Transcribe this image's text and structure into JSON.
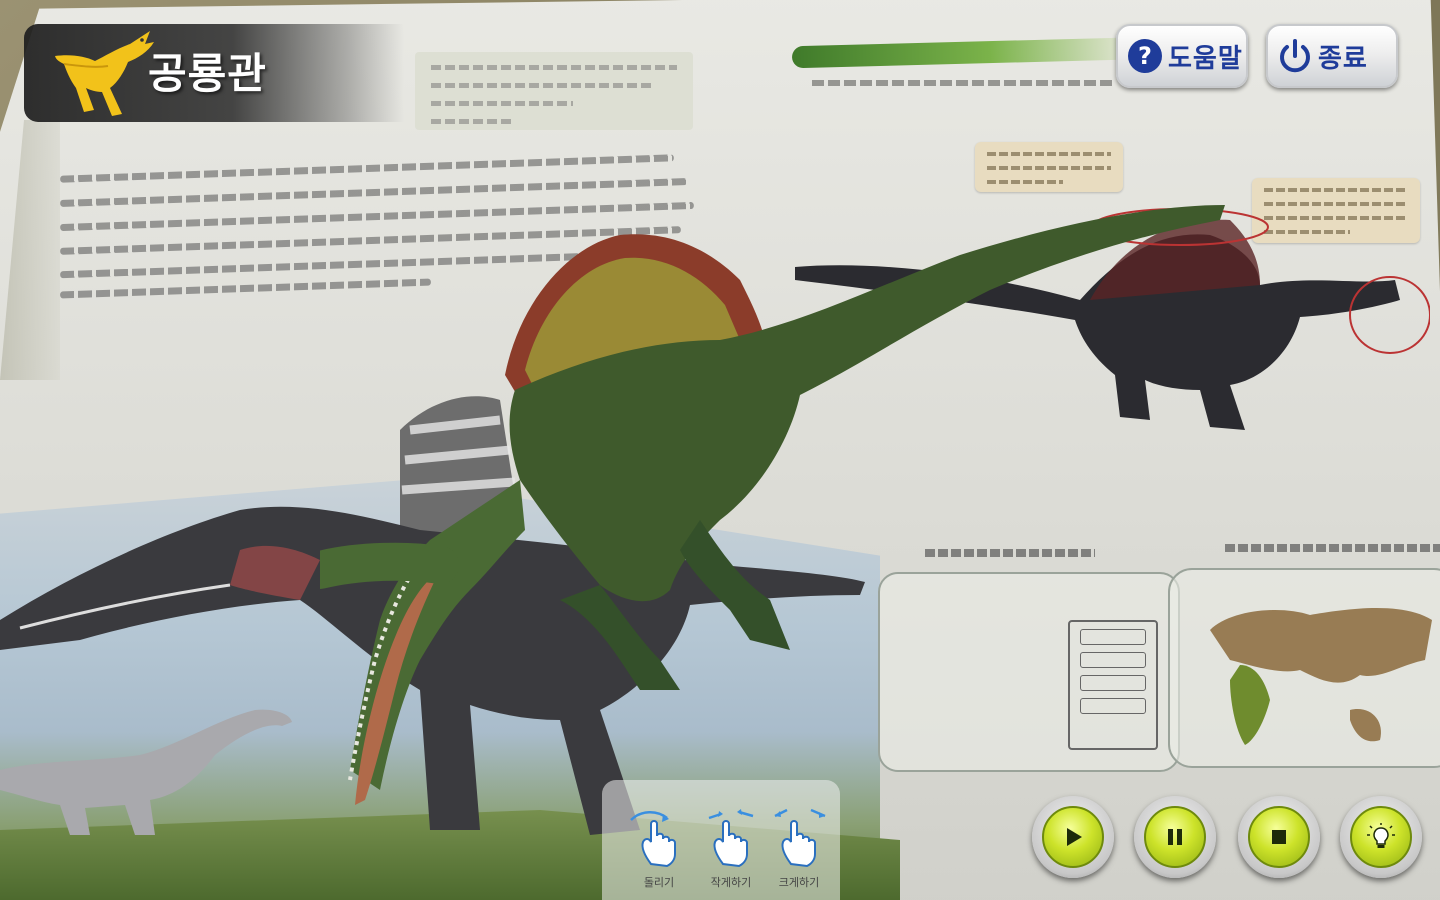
{
  "app": {
    "title": "공룡관"
  },
  "toolbar": {
    "help_label": "도움말",
    "exit_label": "종료"
  },
  "gestures": [
    {
      "label": "돌리기"
    },
    {
      "label": "작게하기"
    },
    {
      "label": "크게하기"
    }
  ],
  "controls": [
    {
      "name": "play"
    },
    {
      "name": "pause"
    },
    {
      "name": "stop"
    },
    {
      "name": "hint"
    }
  ],
  "colors": {
    "title_bar": "#2a2a2a",
    "button_text": "#1f3c9a",
    "control_green": "#b8d21e",
    "logo_yellow": "#f2c21a"
  }
}
